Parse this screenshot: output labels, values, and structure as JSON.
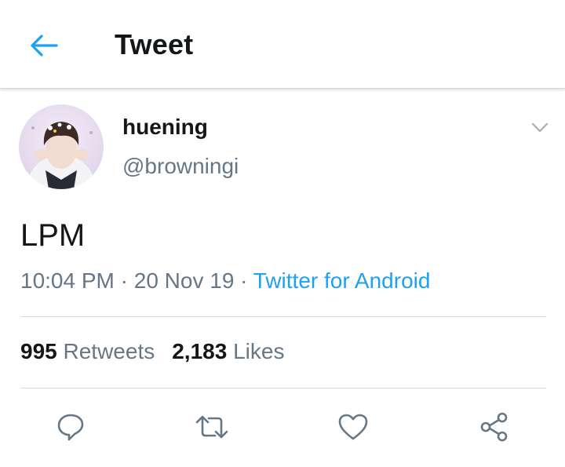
{
  "header": {
    "title": "Tweet",
    "back_icon": "arrow-left-icon"
  },
  "tweet": {
    "author": {
      "display_name": "huening",
      "handle": "@browningi"
    },
    "text": "LPM",
    "time": "10:04 PM",
    "separator": "·",
    "date": "20 Nov 19",
    "source": "Twitter for Android",
    "stats": {
      "retweets_count": "995",
      "retweets_label": "Retweets",
      "likes_count": "2,183",
      "likes_label": "Likes"
    }
  },
  "actions": [
    {
      "icon": "reply-icon"
    },
    {
      "icon": "retweet-icon"
    },
    {
      "icon": "like-icon"
    },
    {
      "icon": "share-icon"
    }
  ],
  "colors": {
    "accent": "#1da1f2",
    "text": "#14171a",
    "secondary": "#657786",
    "divider": "#d6d9dc"
  }
}
